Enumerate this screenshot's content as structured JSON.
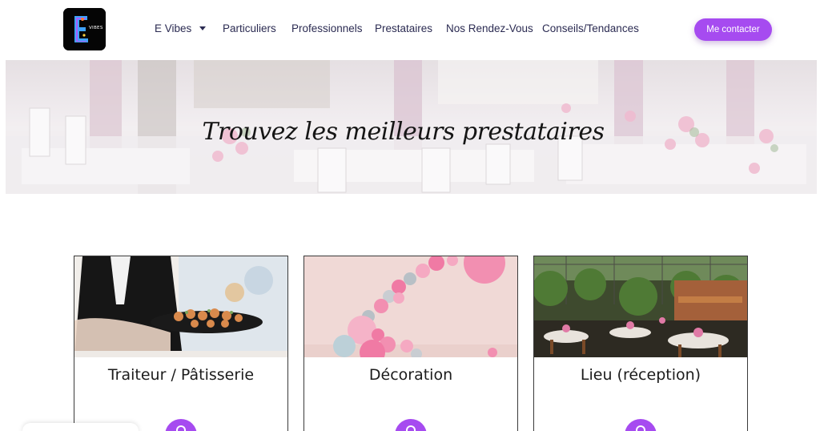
{
  "header": {
    "logo_icon": "e-vibes-logo-icon",
    "logo_text": "VIBES",
    "nav": [
      {
        "label": "E Vibes",
        "has_dropdown": true
      },
      {
        "label": "Particuliers"
      },
      {
        "label": "Professionnels"
      },
      {
        "label": "Prestataires"
      },
      {
        "label": "Nos Rendez-Vous"
      },
      {
        "label": "Conseils/Tendances"
      }
    ],
    "cta_label": "Me contacter"
  },
  "hero": {
    "title": "Trouvez les meilleurs prestataires"
  },
  "cards": [
    {
      "title": "Traiteur / Pâtisserie",
      "icon": "catering-icon"
    },
    {
      "title": "Décoration",
      "icon": "decoration-icon"
    },
    {
      "title": "Lieu (réception)",
      "icon": "venue-icon"
    }
  ],
  "colors": {
    "accent": "#a64bf0",
    "nav_text": "#2b2b52",
    "card_border": "#3a3a3a"
  }
}
